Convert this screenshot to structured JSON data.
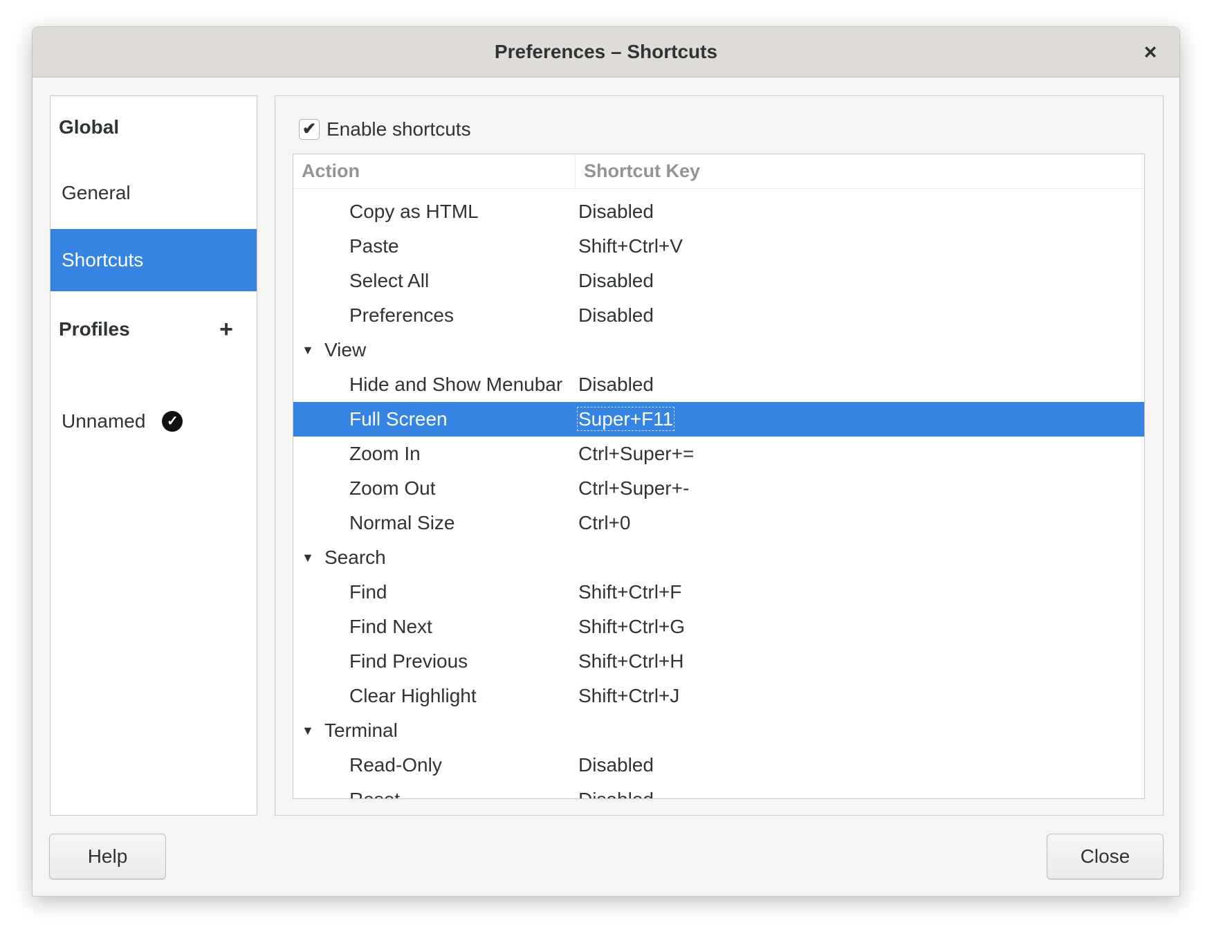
{
  "window": {
    "title": "Preferences – Shortcuts",
    "close_icon": "×"
  },
  "sidebar": {
    "global": "Global",
    "general": "General",
    "shortcuts": "Shortcuts",
    "profiles": "Profiles",
    "add_icon": "+",
    "profile_name": "Unnamed",
    "default_icon": "✓"
  },
  "main": {
    "enable_label": "Enable shortcuts",
    "enable_checked": true,
    "check_glyph": "✔",
    "columns": [
      "Action",
      "Shortcut Key"
    ],
    "rows": [
      {
        "action": "Copy as HTML",
        "key": "Disabled"
      },
      {
        "action": "Paste",
        "key": "Shift+Ctrl+V"
      },
      {
        "action": "Select All",
        "key": "Disabled"
      },
      {
        "action": "Preferences",
        "key": "Disabled"
      },
      {
        "group": "View",
        "expander": "▼"
      },
      {
        "action": "Hide and Show Menubar",
        "key": "Disabled"
      },
      {
        "action": "Full Screen",
        "key": "Super+F11",
        "selected": true
      },
      {
        "action": "Zoom In",
        "key": "Ctrl+Super+="
      },
      {
        "action": "Zoom Out",
        "key": "Ctrl+Super+-"
      },
      {
        "action": "Normal Size",
        "key": "Ctrl+0"
      },
      {
        "group": "Search",
        "expander": "▼"
      },
      {
        "action": "Find",
        "key": "Shift+Ctrl+F"
      },
      {
        "action": "Find Next",
        "key": "Shift+Ctrl+G"
      },
      {
        "action": "Find Previous",
        "key": "Shift+Ctrl+H"
      },
      {
        "action": "Clear Highlight",
        "key": "Shift+Ctrl+J"
      },
      {
        "group": "Terminal",
        "expander": "▼"
      },
      {
        "action": "Read-Only",
        "key": "Disabled"
      },
      {
        "action": "Reset",
        "key": "Disabled"
      }
    ]
  },
  "footer": {
    "help": "Help",
    "close": "Close"
  },
  "colors": {
    "accent": "#3584e4"
  }
}
